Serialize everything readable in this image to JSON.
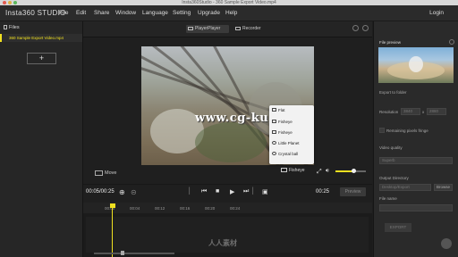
{
  "window": {
    "title": "Insta360Studio - 360 Sample Export Video.mp4"
  },
  "menubar": {
    "app_name": "Insta360 STUDIO",
    "items": [
      "File",
      "Edit",
      "Share",
      "Window",
      "Language",
      "Setting",
      "Upgrade",
      "Help"
    ],
    "login": "Login"
  },
  "files_panel": {
    "title": "Files",
    "file_name": "360 Sample Export Video.mp4",
    "add_label": "+"
  },
  "tabs": {
    "player": "PlayerPlayer",
    "recorder": "Recorder"
  },
  "video": {
    "watermark": "www.cg-ku.com"
  },
  "view_menu": {
    "items": [
      "Flat",
      "Fisheye",
      "Fisheye",
      "Little Planet",
      "Crystal ball"
    ]
  },
  "player": {
    "move_label": "Move",
    "view_mode": "Fisheye",
    "volume": 0.6,
    "time_current": "00:05/00:25",
    "time_end": "00:25",
    "preview_label": "Preview"
  },
  "timeline": {
    "ticks": [
      "00:00",
      "00:04",
      "00:12",
      "00:16",
      "00:20",
      "00:24"
    ],
    "watermark": "人人素材",
    "zoom": 0.35
  },
  "right_panel": {
    "title": "File preview",
    "export_title": "Export to folder",
    "resolution_label": "Resolution",
    "res_w": "3840",
    "res_h": "2880",
    "checkbox_label": "Remaining pixels fringe",
    "quality_label": "Video quality",
    "quality_value": "Superb",
    "output_label": "Output Directory",
    "output_placeholder": "Desktop/Export",
    "browse_label": "Browse",
    "filename_label": "File name",
    "export_label": "EXPORT"
  },
  "colors": {
    "accent": "#f0e020",
    "background": "#1e1e1e"
  }
}
